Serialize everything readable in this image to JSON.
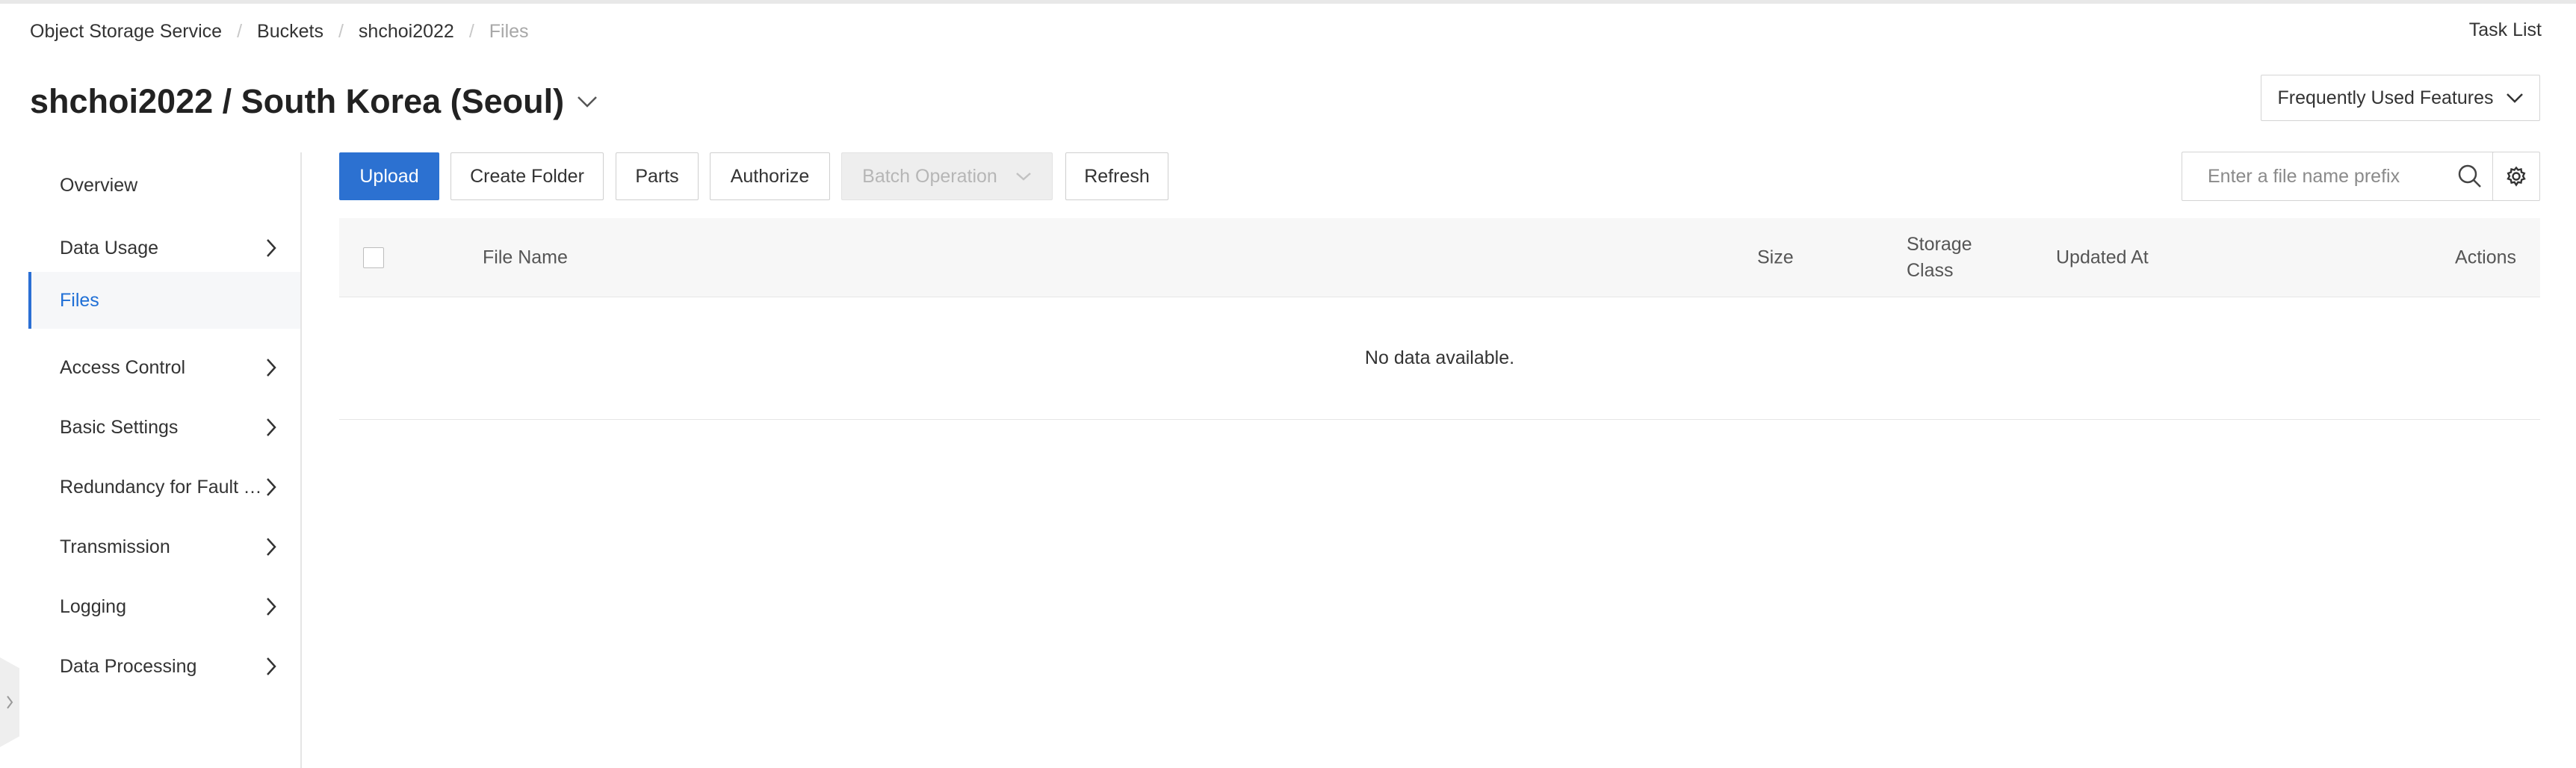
{
  "breadcrumb": {
    "items": [
      "Object Storage Service",
      "Buckets",
      "shchoi2022",
      "Files"
    ],
    "separator": "/"
  },
  "header": {
    "task_list": "Task List",
    "title": "shchoi2022 / South Korea (Seoul)",
    "frequently_used": "Frequently Used Features"
  },
  "sidebar": {
    "items": [
      {
        "label": "Overview",
        "has_arrow": false
      },
      {
        "label": "Data Usage",
        "has_arrow": true
      },
      {
        "label": "Files",
        "has_arrow": false,
        "active": true
      },
      {
        "label": "Access Control",
        "has_arrow": true
      },
      {
        "label": "Basic Settings",
        "has_arrow": true
      },
      {
        "label": "Redundancy for Fault Tolerance",
        "has_arrow": true
      },
      {
        "label": "Transmission",
        "has_arrow": true
      },
      {
        "label": "Logging",
        "has_arrow": true
      },
      {
        "label": "Data Processing",
        "has_arrow": true
      }
    ]
  },
  "toolbar": {
    "upload": "Upload",
    "create_folder": "Create Folder",
    "parts": "Parts",
    "authorize": "Authorize",
    "batch_operation": "Batch Operation",
    "refresh": "Refresh",
    "search_placeholder": "Enter a file name prefix"
  },
  "table": {
    "columns": {
      "file_name": "File Name",
      "size": "Size",
      "storage_class_line1": "Storage",
      "storage_class_line2": "Class",
      "updated_at": "Updated At",
      "actions": "Actions"
    },
    "empty_text": "No data available."
  },
  "colors": {
    "primary": "#2c71d1",
    "active_text": "#1f6fd6",
    "disabled_bg": "#eeeeee"
  }
}
